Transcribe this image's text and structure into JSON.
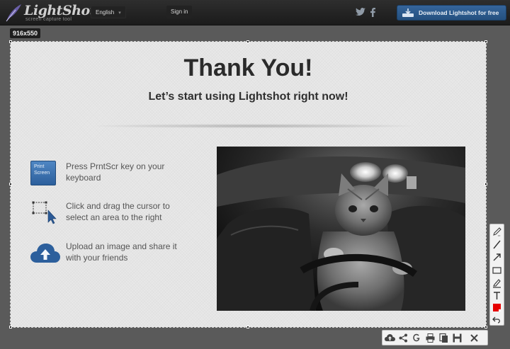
{
  "header": {
    "logo_name": "LightShot",
    "logo_tagline": "screen capture tool",
    "language": "English",
    "sign_in": "Sign in",
    "download_button": "Download Lightshot for free"
  },
  "selection": {
    "size_label": "916x550"
  },
  "main": {
    "title": "Thank You!",
    "subtitle": "Let’s start using Lightshot right now!",
    "key_label": "Print\nScreen",
    "steps": [
      {
        "text": "Press PrntScr key on your keyboard",
        "icon": "print-screen-key-icon"
      },
      {
        "text": "Click and drag the cursor to select an area to the right",
        "icon": "selection-cursor-icon"
      },
      {
        "text": "Upload an image and share it with your friends",
        "icon": "cloud-upload-icon"
      }
    ]
  },
  "colors": {
    "accent": "#2c5f9c",
    "selected_color": "#e60000"
  }
}
